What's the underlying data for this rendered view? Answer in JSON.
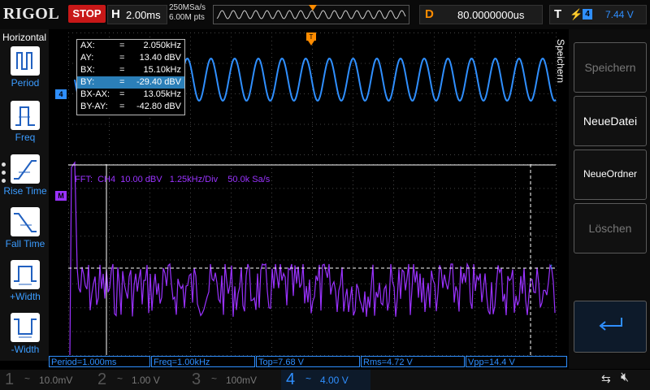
{
  "top_bar": {
    "brand": "RIGOL",
    "run_state": "STOP",
    "timebase_letter": "H",
    "timebase_value": "2.00ms",
    "sample_rate": "250MSa/s",
    "memory_depth": "6.00M pts",
    "trigger_position_label": "T",
    "delay_letter": "D",
    "delay_value": "80.0000000us",
    "trigger_letter": "T",
    "trigger_edge": "⚡",
    "trigger_channel": "4",
    "trigger_level": "7.44 V"
  },
  "left_panel": {
    "title": "Horizontal",
    "items": [
      {
        "label": "Period",
        "icon": "period-icon"
      },
      {
        "label": "Freq",
        "icon": "freq-icon"
      },
      {
        "label": "Rise Time",
        "icon": "rise-time-icon"
      },
      {
        "label": "Fall Time",
        "icon": "fall-time-icon"
      },
      {
        "label": "+Width",
        "icon": "pos-width-icon"
      },
      {
        "label": "-Width",
        "icon": "neg-width-icon"
      }
    ]
  },
  "cursors": [
    {
      "key": "AX:",
      "value": "2.050kHz"
    },
    {
      "key": "AY:",
      "value": "13.40 dBV"
    },
    {
      "key": "BX:",
      "value": "15.10kHz"
    },
    {
      "key": "BY:",
      "value": "-29.40 dBV",
      "selected": true
    },
    {
      "key": "BX-AX:",
      "value": "13.05kHz"
    },
    {
      "key": "BY-AY:",
      "value": "-42.80 dBV"
    }
  ],
  "fft_label": "FFT:  CH4  10.00 dBV   1.25kHz/Div    50.0k Sa/s",
  "markers": {
    "ch4": "4",
    "math": "M"
  },
  "measurements": [
    "Period=1.000ms",
    "Freq=1.00kHz",
    "Top=7.68 V",
    "Rms=4.72 V",
    "Vpp=14.4 V"
  ],
  "channels": [
    {
      "num": "1",
      "coupling": "~",
      "scale": "10.0mV"
    },
    {
      "num": "2",
      "coupling": "~",
      "scale": "1.00 V"
    },
    {
      "num": "3",
      "coupling": "~",
      "scale": "100mV"
    },
    {
      "num": "4",
      "coupling": "~",
      "scale": "4.00 V"
    }
  ],
  "right_panel": {
    "title": "Speichern",
    "buttons": [
      "Speichern",
      "NeueDatei",
      "NeueOrdner",
      "Löschen"
    ]
  },
  "colors": {
    "ch4": "#2f8fff",
    "math": "#9a32ff",
    "trigger": "#ff8c00",
    "stop": "#c81818"
  }
}
